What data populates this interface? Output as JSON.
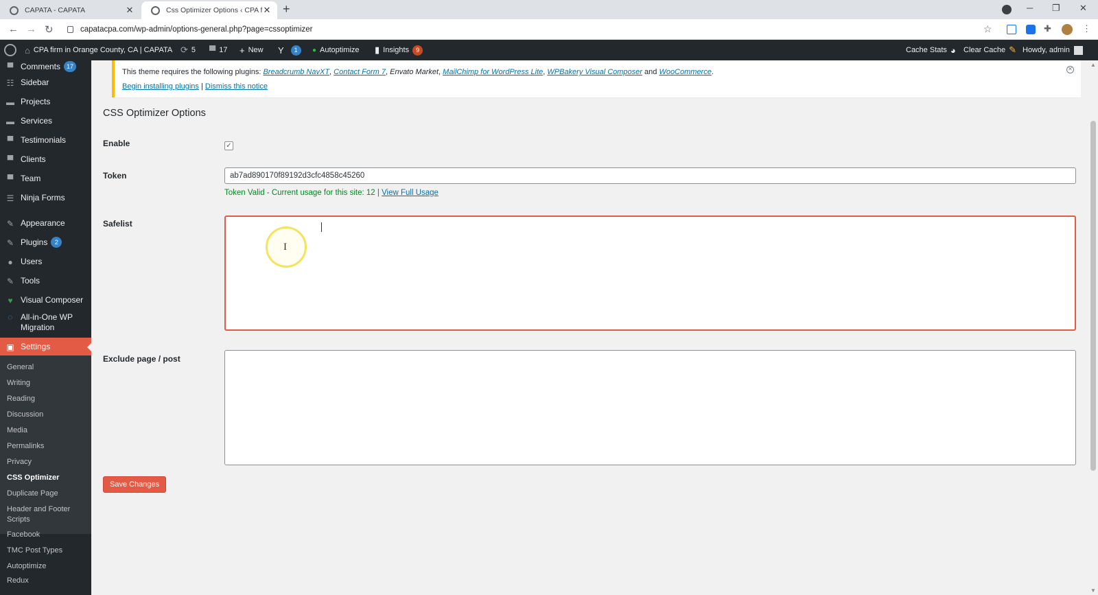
{
  "browser": {
    "tabs": [
      {
        "title": "CAPATA - CAPATA"
      },
      {
        "title": "Css Optimizer Options ‹ CPA firm"
      }
    ],
    "url": "capatacpa.com/wp-admin/options-general.php?page=cssoptimizer"
  },
  "adminbar": {
    "site_name": "CPA firm in Orange County, CA | CAPATA",
    "updates_count": "5",
    "comments_count": "17",
    "new_label": "New",
    "yoast_badge": "1",
    "autoptimize_label": "Autoptimize",
    "insights_label": "Insights",
    "insights_badge": "9",
    "cache_stats_label": "Cache Stats",
    "clear_cache_label": "Clear Cache",
    "howdy_label": "Howdy, admin"
  },
  "sidebar": {
    "items": [
      {
        "label": "Comments",
        "badge": "17",
        "icon": "comments-icon"
      },
      {
        "label": "Sidebar",
        "icon": "sidebar-icon"
      },
      {
        "label": "Projects",
        "icon": "folder-icon"
      },
      {
        "label": "Services",
        "icon": "folder-icon"
      },
      {
        "label": "Testimonials",
        "icon": "quote-icon"
      },
      {
        "label": "Clients",
        "icon": "clients-icon"
      },
      {
        "label": "Team",
        "icon": "team-icon"
      },
      {
        "label": "Ninja Forms",
        "icon": "forms-icon"
      },
      {
        "label": "Appearance",
        "icon": "brush-icon"
      },
      {
        "label": "Plugins",
        "badge": "2",
        "icon": "plugin-icon"
      },
      {
        "label": "Users",
        "icon": "user-icon"
      },
      {
        "label": "Tools",
        "icon": "wrench-icon"
      },
      {
        "label": "Visual Composer",
        "icon": "visual-composer-icon"
      },
      {
        "label": "All-in-One WP Migration",
        "icon": "migration-icon"
      },
      {
        "label": "Settings",
        "icon": "settings-icon"
      }
    ],
    "submenu": [
      "General",
      "Writing",
      "Reading",
      "Discussion",
      "Media",
      "Permalinks",
      "Privacy",
      "CSS Optimizer",
      "Duplicate Page",
      "Header and Footer Scripts",
      "Facebook",
      "TMC Post Types",
      "Autoptimize",
      "Redux"
    ]
  },
  "notice": {
    "prefix": "This theme requires the following plugins:",
    "plugins": [
      "Breadcrumb NavXT",
      "Contact Form 7",
      "Envato Market",
      "MailChimp for WordPress Lite",
      "WPBakery Visual Composer",
      "WooCommerce"
    ],
    "and_word": "and",
    "begin_link": "Begin installing plugins",
    "separator": "|",
    "dismiss_link": "Dismiss this notice"
  },
  "page": {
    "title": "CSS Optimizer Options",
    "enable_label": "Enable",
    "enable_checked": true,
    "token_label": "Token",
    "token_value": "ab7ad890170f89192d3cfc4858c45260",
    "token_status": "Token Valid - Current usage for this site: 12 |",
    "view_usage_link": "View Full Usage",
    "safelist_label": "Safelist",
    "safelist_value": "",
    "exclude_label": "Exclude page / post",
    "exclude_value": "",
    "save_button": "Save Changes"
  },
  "colors": {
    "accent": "#e45b45",
    "adminbar_bg": "#23282d",
    "link": "#0073aa",
    "success": "#008a20"
  }
}
